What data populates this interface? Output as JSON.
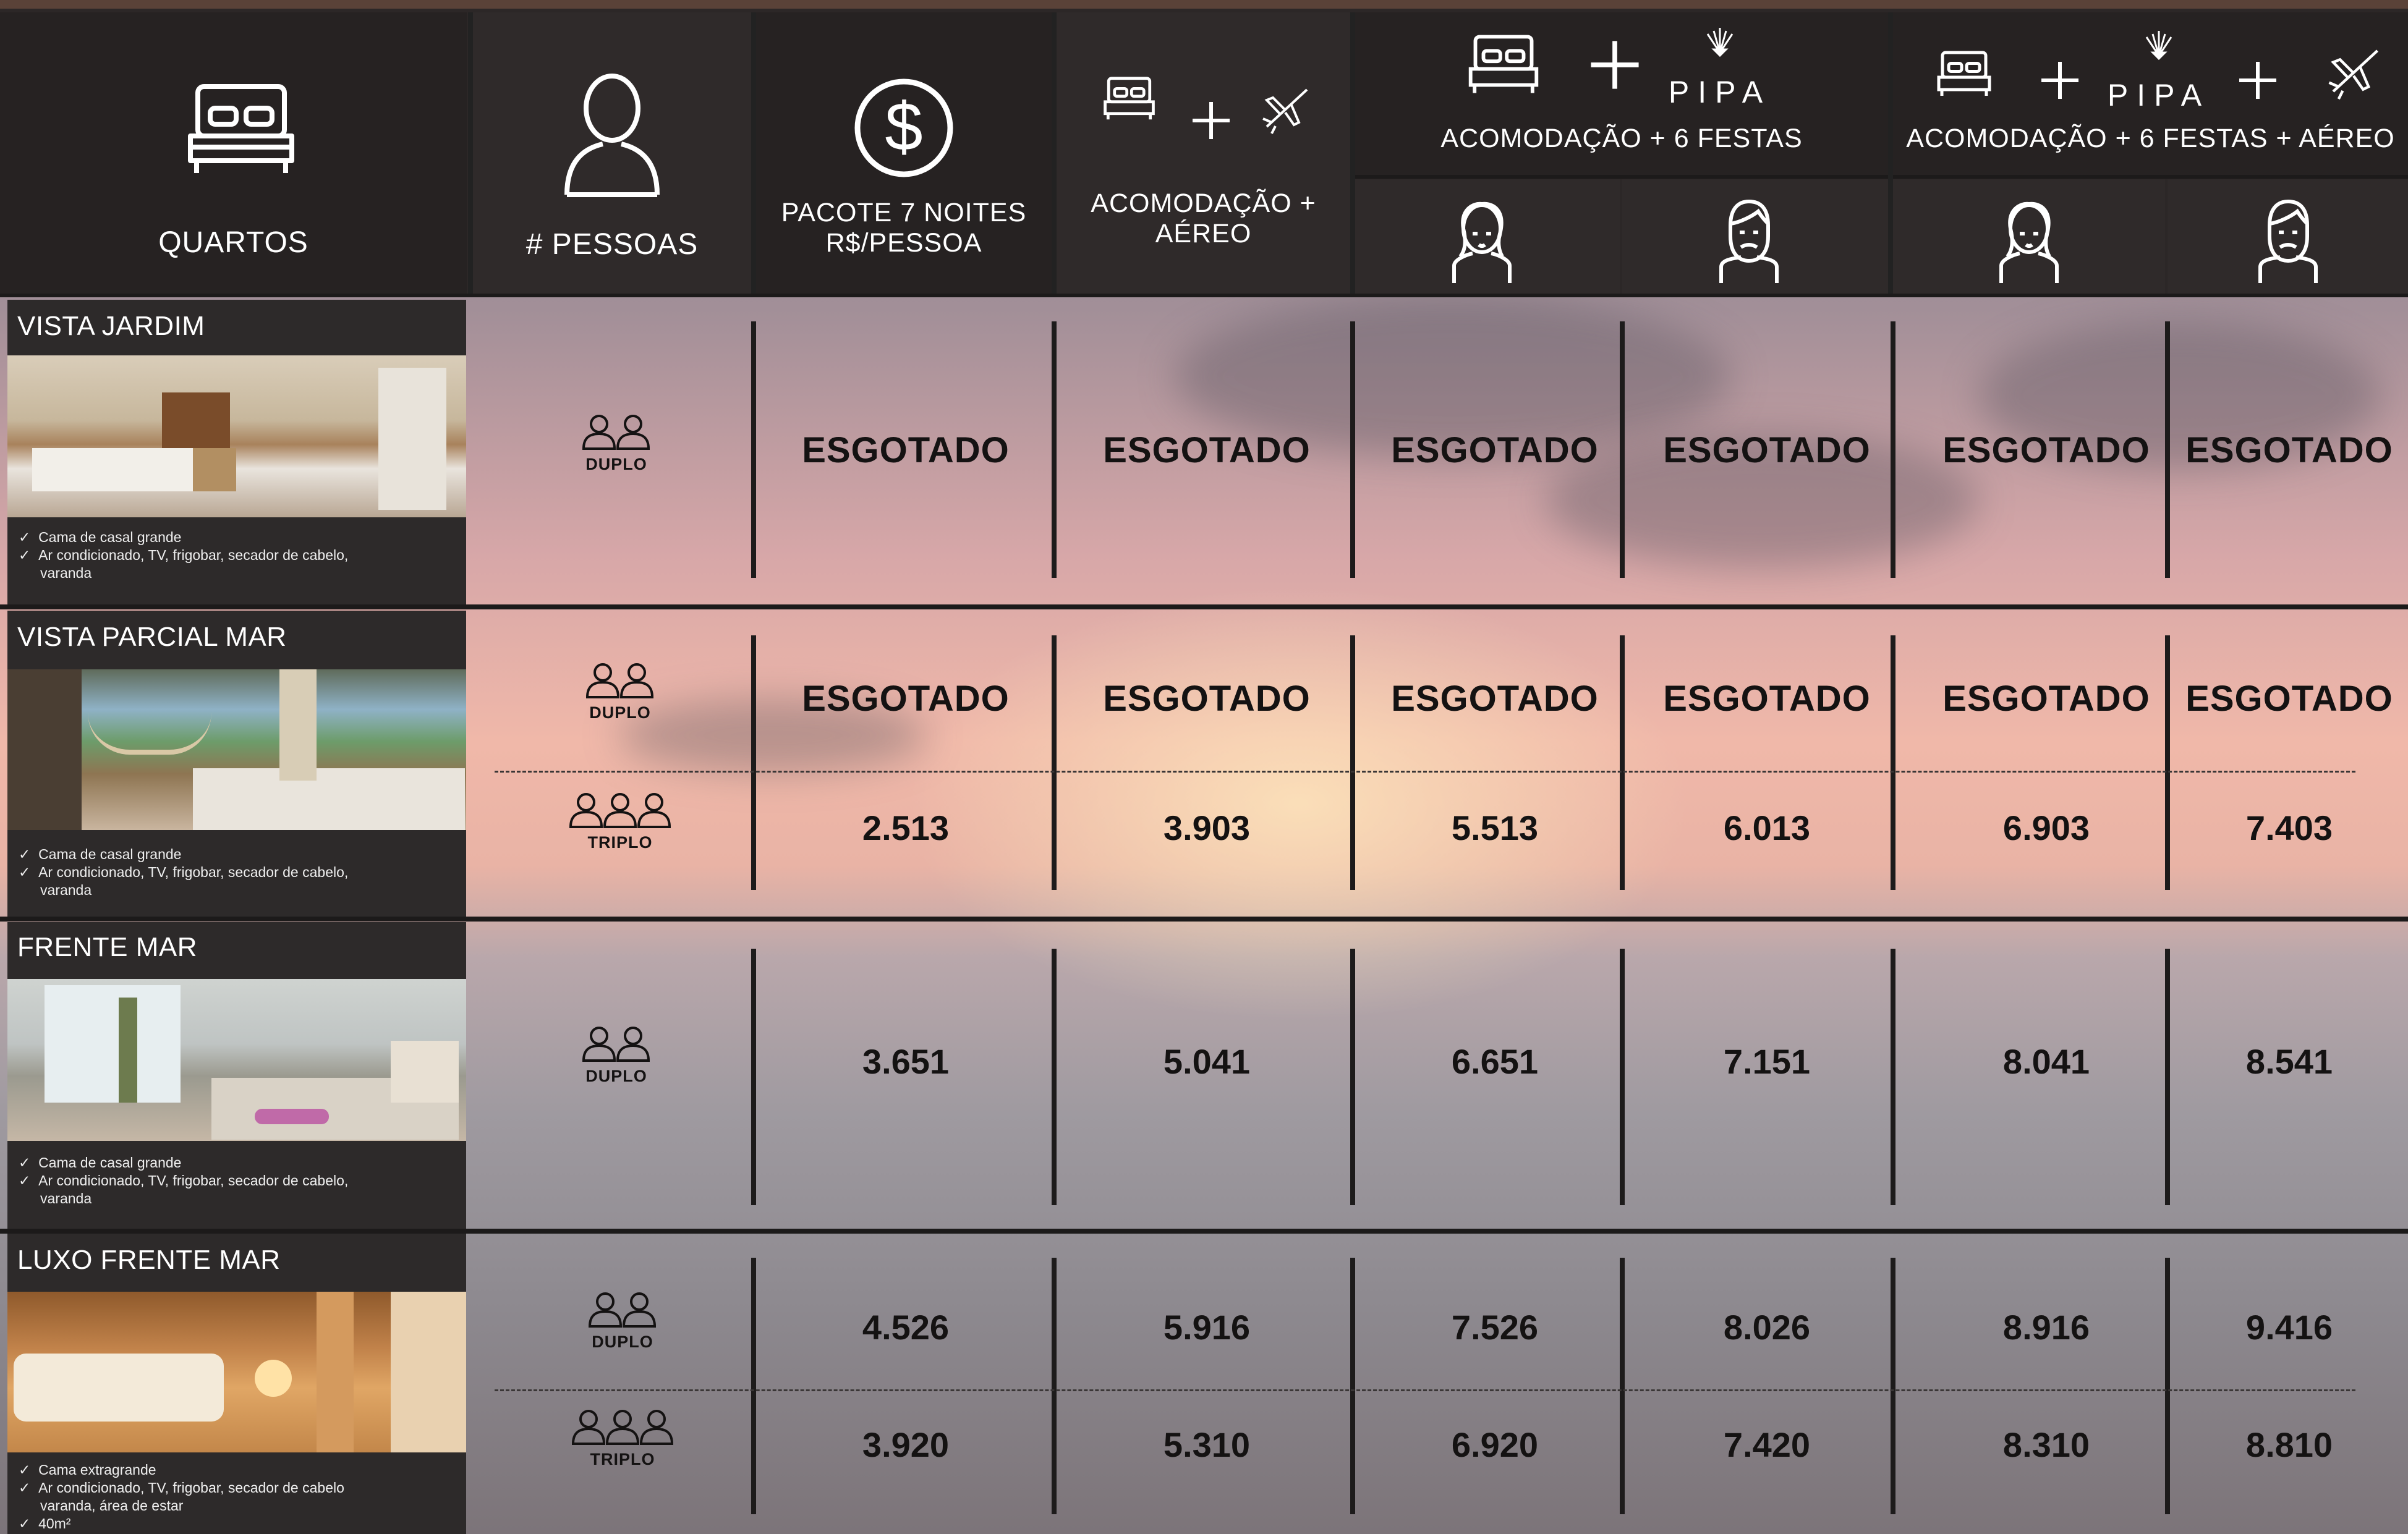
{
  "header": {
    "quartos": "QUARTOS",
    "pessoas": "# PESSOAS",
    "pacote_line1": "PACOTE 7 NOITES",
    "pacote_line2": "R$/PESSOA",
    "acom_aereo_line1": "ACOMODAÇÃO +",
    "acom_aereo_line2": "AÉREO",
    "pipa_logo": "PIPA",
    "acom_festas": "ACOMODAÇÃO + 6 FESTAS",
    "acom_festas_aereo": "ACOMODAÇÃO + 6 FESTAS + AÉREO"
  },
  "icons": [
    "bed-icon",
    "person-icon",
    "dollar-icon",
    "plane-icon",
    "plus-icon",
    "woman-icon",
    "man-icon",
    "people-icon"
  ],
  "rooms": [
    {
      "name": "VISTA JARDIM",
      "features": [
        "Cama de casal grande",
        "Ar condicionado, TV, frigobar, secador de cabelo,",
        "varanda"
      ],
      "rows": [
        {
          "label": "DUPLO",
          "values": [
            "ESGOTADO",
            "ESGOTADO",
            "ESGOTADO",
            "ESGOTADO",
            "ESGOTADO",
            "ESGOTADO"
          ]
        }
      ]
    },
    {
      "name": "VISTA PARCIAL MAR",
      "features": [
        "Cama de casal grande",
        "Ar condicionado, TV, frigobar, secador de cabelo,",
        "varanda"
      ],
      "rows": [
        {
          "label": "DUPLO",
          "values": [
            "ESGOTADO",
            "ESGOTADO",
            "ESGOTADO",
            "ESGOTADO",
            "ESGOTADO",
            "ESGOTADO"
          ]
        },
        {
          "label": "TRIPLO",
          "values": [
            "2.513",
            "3.903",
            "5.513",
            "6.013",
            "6.903",
            "7.403"
          ]
        }
      ]
    },
    {
      "name": "FRENTE MAR",
      "features": [
        "Cama de casal grande",
        "Ar condicionado, TV, frigobar, secador de cabelo,",
        "varanda"
      ],
      "rows": [
        {
          "label": "DUPLO",
          "values": [
            "3.651",
            "5.041",
            "6.651",
            "7.151",
            "8.041",
            "8.541"
          ]
        }
      ]
    },
    {
      "name": "LUXO FRENTE MAR",
      "features": [
        "Cama extragrande",
        "Ar condicionado, TV, frigobar, secador de cabelo",
        "varanda, área de estar",
        "40m²"
      ],
      "rows": [
        {
          "label": "DUPLO",
          "values": [
            "4.526",
            "5.916",
            "7.526",
            "8.026",
            "8.916",
            "9.416"
          ]
        },
        {
          "label": "TRIPLO",
          "values": [
            "3.920",
            "5.310",
            "6.920",
            "7.420",
            "8.310",
            "8.810"
          ]
        }
      ]
    }
  ]
}
